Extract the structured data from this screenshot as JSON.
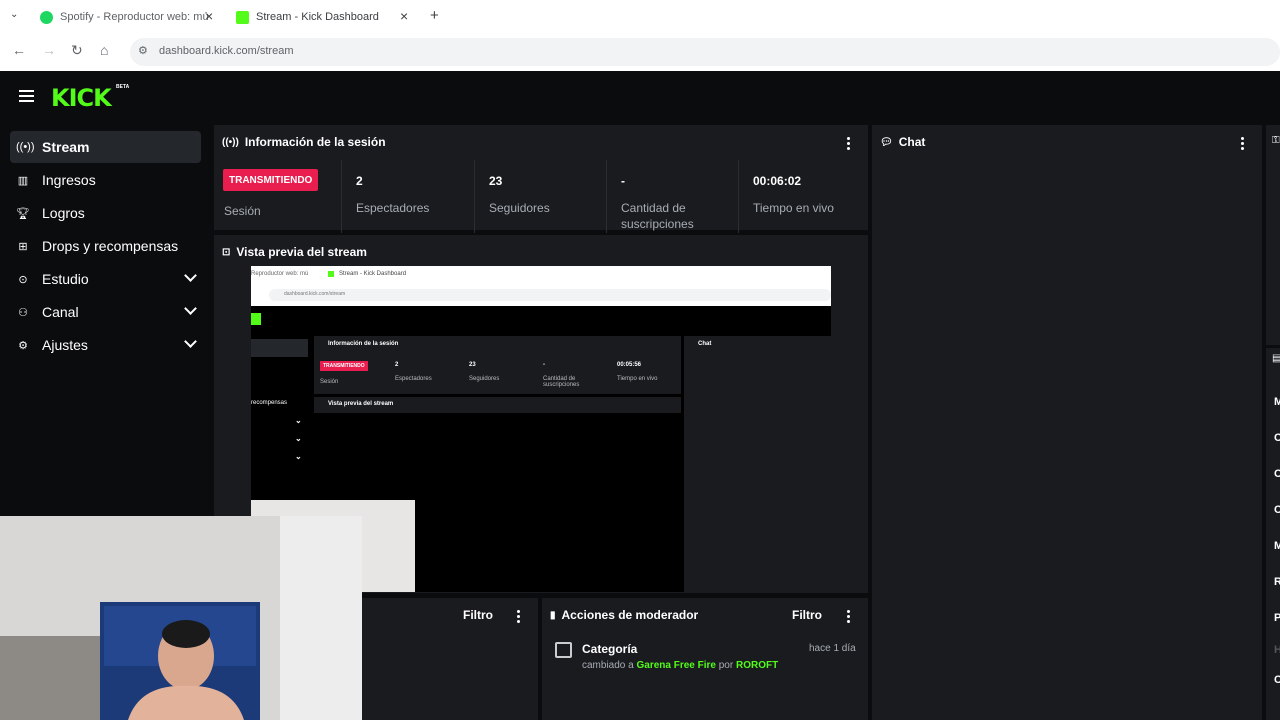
{
  "browser": {
    "tabs": [
      {
        "title": "Spotify - Reproductor web: mú",
        "icon": "spotify-icon"
      },
      {
        "title": "Stream - Kick Dashboard",
        "icon": "kick-icon"
      }
    ],
    "url": "dashboard.kick.com/stream"
  },
  "app": {
    "logo": "KICK",
    "logo_badge": "BETA"
  },
  "sidebar": {
    "items": [
      {
        "label": "Stream",
        "icon": "stream-icon"
      },
      {
        "label": "Ingresos",
        "icon": "chart-icon"
      },
      {
        "label": "Logros",
        "icon": "trophy-icon"
      },
      {
        "label": "Drops y recompensas",
        "icon": "drops-icon"
      },
      {
        "label": "Estudio",
        "icon": "studio-icon"
      },
      {
        "label": "Canal",
        "icon": "channel-icon"
      },
      {
        "label": "Ajustes",
        "icon": "gear-icon"
      }
    ]
  },
  "session": {
    "title": "Información de la sesión",
    "status": "TRANSMITIENDO",
    "status_label": "Sesión",
    "stats": [
      {
        "value": "2",
        "label": "Espectadores"
      },
      {
        "value": "23",
        "label": "Seguidores"
      },
      {
        "value": "-",
        "label": "Cantidad de suscripciones"
      },
      {
        "value": "00:06:02",
        "label": "Tiempo en vivo"
      }
    ]
  },
  "preview": {
    "title": "Vista previa del stream",
    "mini": {
      "tab1": "Reproductor web: mú",
      "tab2": "Stream - Kick Dashboard",
      "url": "dashboard.kick.com/stream",
      "session_title": "Información de la sesión",
      "chat_title": "Chat",
      "status": "TRANSMITIENDO",
      "status_label": "Sesión",
      "stats": [
        {
          "value": "2",
          "label": "Espectadores"
        },
        {
          "value": "23",
          "label": "Seguidores"
        },
        {
          "value": "-",
          "label": "Cantidad de suscripciones"
        },
        {
          "value": "00:05:56",
          "label": "Tiempo en vivo"
        }
      ],
      "preview_title": "Vista previa del stream",
      "sidebar_partial": "recompensas"
    }
  },
  "chat": {
    "title": "Chat"
  },
  "activity": {
    "filter_label": "Filtro"
  },
  "mod_actions": {
    "title": "Acciones de moderador",
    "filter_label": "Filtro",
    "items": [
      {
        "title": "Categoría",
        "prefix": "cambiado a",
        "category": "Garena Free Fire",
        "by": "por",
        "user": "ROROFT",
        "time": "hace 1 día"
      }
    ]
  },
  "right_edge": {
    "letters": [
      "M",
      "C",
      "C",
      "C",
      "M",
      "R",
      "P",
      "H",
      "C"
    ]
  },
  "colors": {
    "accent": "#53fc18",
    "live": "#e91e4e",
    "panel": "#191b1f",
    "background": "#0b0c0e"
  }
}
